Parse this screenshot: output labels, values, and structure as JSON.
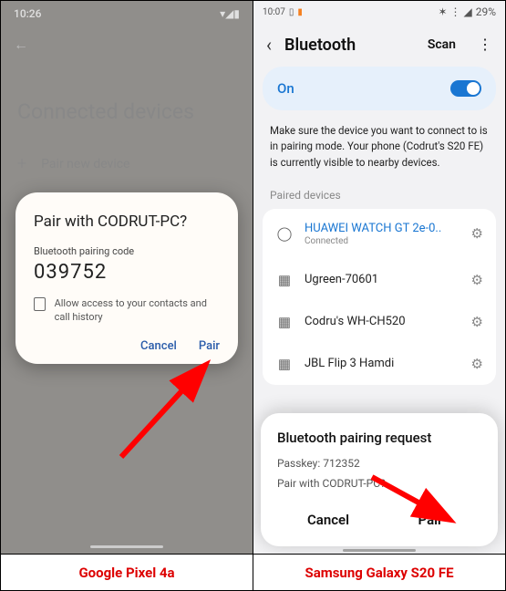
{
  "pixel": {
    "time": "10:26",
    "page_title": "Connected devices",
    "pair_row": "Pair new device",
    "dialog": {
      "title": "Pair with CODRUT-PC?",
      "code_label": "Bluetooth pairing code",
      "code": "039752",
      "checkbox_label": "Allow access to your contacts and call history",
      "cancel": "Cancel",
      "pair": "Pair"
    },
    "caption": "Google Pixel 4a"
  },
  "samsung": {
    "time": "10:07",
    "battery": "29%",
    "title": "Bluetooth",
    "scan": "Scan",
    "on_label": "On",
    "info_text": "Make sure the device you want to connect to is in pairing mode. Your phone (Codrut's S20 FE) is currently visible to nearby devices.",
    "section_label": "Paired devices",
    "devices": [
      {
        "name": "HUAWEI WATCH GT 2e-0..",
        "status": "Connected",
        "accent": true,
        "icon": "watch"
      },
      {
        "name": "Ugreen-70601",
        "status": "",
        "accent": false,
        "icon": "qr"
      },
      {
        "name": "Codru's WH-CH520",
        "status": "",
        "accent": false,
        "icon": "qr"
      },
      {
        "name": "JBL Flip 3 Hamdi",
        "status": "",
        "accent": false,
        "icon": "qr"
      }
    ],
    "dialog": {
      "title": "Bluetooth pairing request",
      "passkey_label": "Passkey:",
      "passkey": "712352",
      "pair_with": "Pair with CODRUT-PC?",
      "cancel": "Cancel",
      "pair": "Pair"
    },
    "caption": "Samsung Galaxy S20 FE"
  }
}
